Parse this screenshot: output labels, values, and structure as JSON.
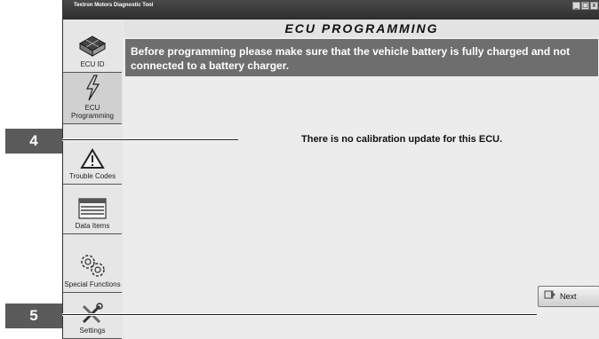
{
  "window": {
    "title": "Textron Motors Diagnostic Tool",
    "controls": {
      "minimize": "_",
      "maximize": "□",
      "close": "x"
    }
  },
  "sidebar": {
    "items": [
      {
        "label": "ECU ID",
        "icon": "chip-icon"
      },
      {
        "label": "ECU Programming",
        "icon": "lightning-icon"
      },
      {
        "label": "Trouble Codes",
        "icon": "warning-icon"
      },
      {
        "label": "Data Items",
        "icon": "list-icon"
      },
      {
        "label": "Special Functions",
        "icon": "gears-icon"
      },
      {
        "label": "Settings",
        "icon": "tools-icon"
      }
    ]
  },
  "main": {
    "title": "ECU PROGRAMMING",
    "notice": "Before programming please make sure that the vehicle battery is fully charged and not connected to a battery charger.",
    "message": "There is no calibration update for this ECU.",
    "next_label": "Next"
  },
  "callouts": {
    "first": "4",
    "second": "5"
  },
  "colors": {
    "notice_bg": "#6e6e6e",
    "titlebar_bg": "#3a3a3a",
    "callout_bg": "#5a5a5a"
  }
}
